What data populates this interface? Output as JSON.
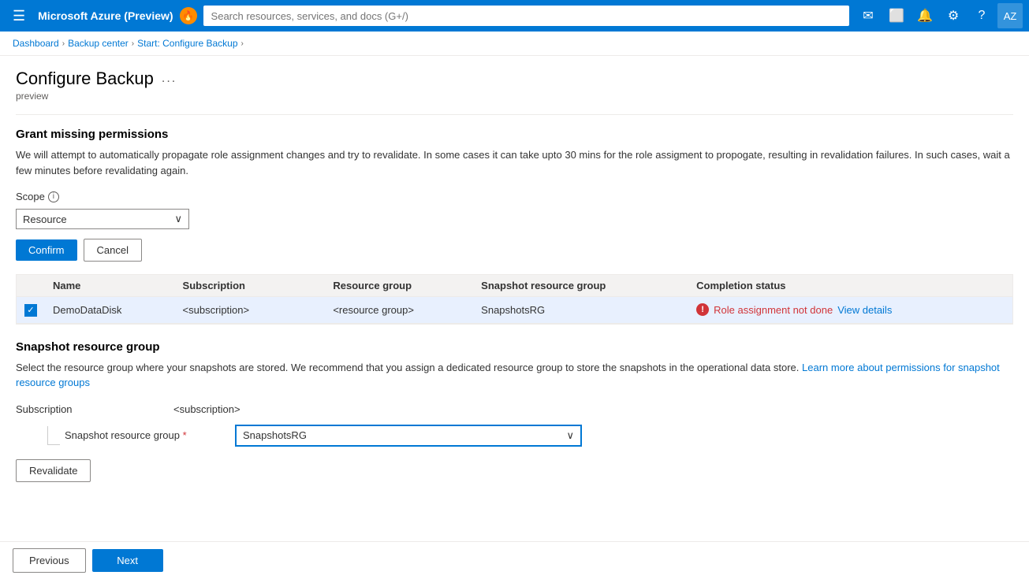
{
  "topbar": {
    "title": "Microsoft Azure (Preview)",
    "badge": "🔔",
    "search_placeholder": "Search resources, services, and docs (G+/)",
    "icons": [
      "✉",
      "📋",
      "🔔",
      "⚙",
      "?"
    ]
  },
  "breadcrumb": {
    "items": [
      {
        "label": "Dashboard",
        "link": true
      },
      {
        "label": "Backup center",
        "link": true
      },
      {
        "label": "Start: Configure Backup",
        "link": true
      }
    ],
    "separator": "›"
  },
  "page": {
    "title": "Configure Backup",
    "title_ellipsis": "...",
    "subtitle": "preview"
  },
  "grant_section": {
    "title": "Grant missing permissions",
    "description": "We will attempt to automatically propagate role assignment changes and try to revalidate. In some cases it can take upto 30 mins for the role assigment to propogate, resulting in revalidation failures. In such cases, wait a few minutes before revalidating again.",
    "scope_label": "Scope",
    "scope_value": "Resource",
    "confirm_label": "Confirm",
    "cancel_label": "Cancel"
  },
  "table": {
    "headers": [
      "",
      "Name",
      "Subscription",
      "",
      "Resource group",
      "Snapshot resource group",
      "Completion status"
    ],
    "rows": [
      {
        "checked": true,
        "name": "DemoDataDisk",
        "subscription": "<subscription>",
        "extra": "",
        "resource_group": "<resource group>",
        "snapshot_rg": "SnapshotsRG",
        "status": "Role assignment not done",
        "view_link": "View details"
      }
    ]
  },
  "snapshot_section": {
    "title": "Snapshot resource group",
    "description": "Select the resource group where your snapshots are stored. We recommend that you assign a dedicated resource group to store the snapshots in the operational data store.",
    "learn_link_text": "Learn more about permissions for snapshot resource groups",
    "subscription_label": "Subscription",
    "subscription_value": "<subscription>",
    "rg_label": "Snapshot resource group",
    "rg_required": true,
    "rg_value": "SnapshotsRG",
    "revalidate_label": "Revalidate"
  },
  "footer": {
    "previous_label": "Previous",
    "next_label": "Next"
  }
}
